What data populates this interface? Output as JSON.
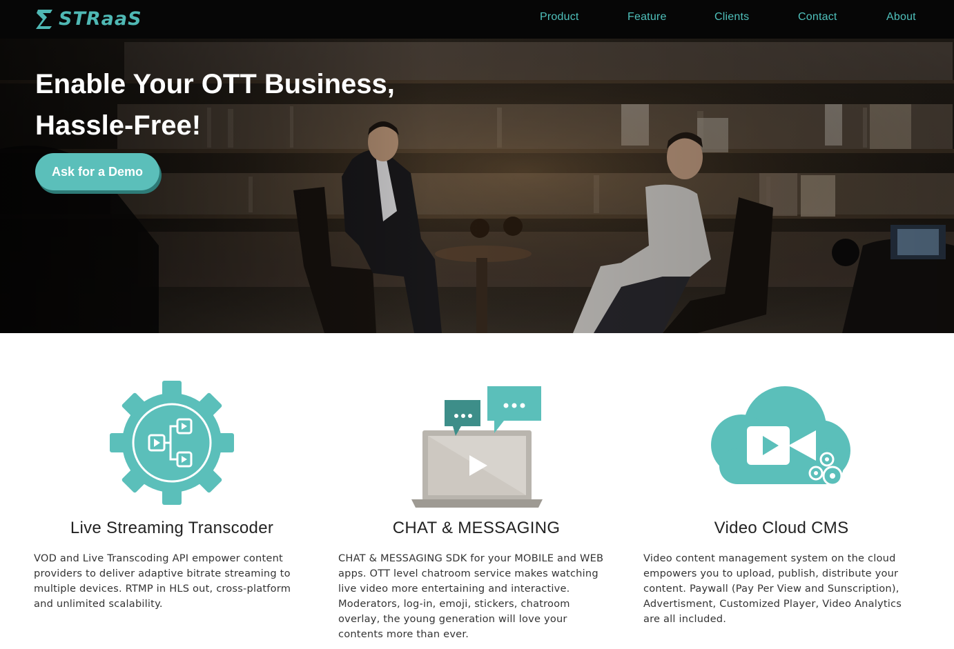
{
  "nav": {
    "brand": "STRaaS",
    "items": [
      {
        "label": "Product"
      },
      {
        "label": "Feature"
      },
      {
        "label": "Clients"
      },
      {
        "label": "Contact"
      },
      {
        "label": "About"
      }
    ]
  },
  "hero": {
    "title_line1": "Enable Your OTT Business,",
    "title_line2": "Hassle-Free!",
    "cta_label": "Ask for a Demo"
  },
  "features": [
    {
      "icon": "gear-workflow-icon",
      "title": "Live Streaming Transcoder",
      "description": "VOD and Live Transcoding API empower content providers to deliver adaptive bitrate streaming to multiple devices. RTMP in HLS out, cross-platform and unlimited scalability."
    },
    {
      "icon": "laptop-chat-icon",
      "title": "CHAT & MESSAGING",
      "description": "CHAT & MESSAGING SDK for your MOBILE and WEB apps. OTT level chatroom service makes watching live video more entertaining and interactive. Moderators, log-in, emoji, stickers, chatroom overlay, the young generation will love your contents more than ever."
    },
    {
      "icon": "cloud-video-icon",
      "title": "Video Cloud CMS",
      "description": "Video content management system on the cloud empowers you to upload, publish, distribute your content. Paywall (Pay Per View and Sunscription), Advertisment, Customized Player, Video Analytics are all included."
    }
  ],
  "colors": {
    "accent": "#5bbfba",
    "nav_bg": "#060606",
    "icon_gray": "#b9b5ae",
    "chat_dark": "#3d8e89"
  }
}
